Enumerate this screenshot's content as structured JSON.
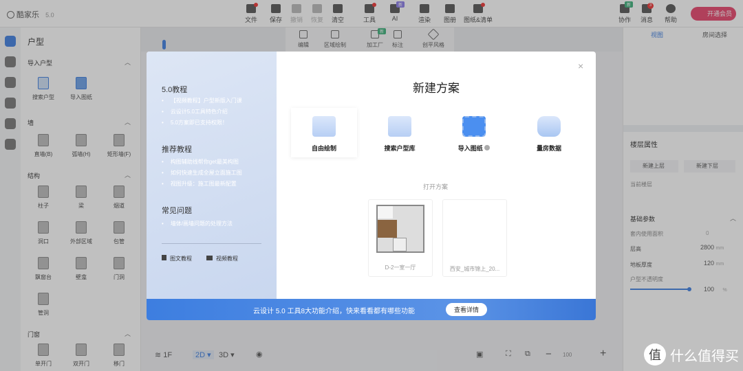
{
  "app": {
    "logo": "酷家乐",
    "version": "5.0"
  },
  "toolbar": [
    {
      "label": "文件",
      "dot": true
    },
    {
      "label": "保存"
    },
    {
      "label": "撤销"
    },
    {
      "label": "恢复"
    },
    {
      "label": "清空"
    },
    {
      "label": "工具",
      "dot": true
    },
    {
      "label": "AI",
      "badge": "新"
    },
    {
      "label": "渲染"
    },
    {
      "label": "图册"
    },
    {
      "label": "图纸&清单",
      "dot": true
    }
  ],
  "toolbar_right": {
    "collab": "协作",
    "collab_badge": "新",
    "messages": "消息",
    "message_count": "3",
    "help": "帮助",
    "vip": "开通会员"
  },
  "subtoolbar": [
    {
      "label": "编辑"
    },
    {
      "label": "区域绘制"
    },
    {
      "label": "加工厂",
      "badge": "新"
    },
    {
      "label": "标注"
    },
    {
      "label": "创平风格"
    }
  ],
  "sidebar": {
    "title": "户型",
    "sections": [
      {
        "title": "导入户型",
        "items": [
          "搜索户型",
          "导入图纸"
        ]
      },
      {
        "title": "墙",
        "items": [
          "直墙(B)",
          "弧墙(H)",
          "矩形墙(F)"
        ]
      },
      {
        "title": "结构",
        "items": [
          "柱子",
          "梁",
          "烟道",
          "洞口",
          "外部区域",
          "包管",
          "飘窗台",
          "壁龛",
          "门洞",
          "管洞"
        ]
      },
      {
        "title": "门窗",
        "items": [
          "单开门",
          "双开门",
          "移门"
        ]
      }
    ]
  },
  "right_panel": {
    "tabs": [
      "视图",
      "房间选择"
    ],
    "floor_title": "楼层属性",
    "new_upper": "新建上层",
    "new_lower": "新建下层",
    "current_floor": "当前楼层",
    "params_title": "基础参数",
    "inner_area": "套内使用面积",
    "inner_area_value": "0",
    "height_label": "层高",
    "height_value": "2800",
    "height_unit": "mm",
    "floor_thick_label": "地板厚度",
    "floor_thick_value": "120",
    "floor_thick_unit": "mm",
    "opacity_label": "户型不透明度",
    "opacity_value": "100",
    "opacity_unit": "%"
  },
  "bottom": {
    "floor": "1F",
    "mode2d": "2D",
    "mode3d": "3D",
    "zoom": "100"
  },
  "modal": {
    "title": "新建方案",
    "left": {
      "sec1": "5.0教程",
      "sec1_items": [
        "【视频教程】户型新版入门课",
        "云设计5.0工具特色介绍",
        "5.0方案即已支持权限！"
      ],
      "sec2": "推荐教程",
      "sec2_items": [
        "构图辅助线帮你get最美构图",
        "如何快速生成全屋立面施工图",
        "视图升级：施工图最新配置"
      ],
      "sec3": "常见问题",
      "sec3_items": [
        "墙体/画墙问题的处理方法"
      ],
      "link_doc": "图文教程",
      "link_video": "视频教程"
    },
    "options": [
      {
        "label": "自由绘制"
      },
      {
        "label": "搜索户型库"
      },
      {
        "label": "导入图纸"
      },
      {
        "label": "量房数据"
      }
    ],
    "open_title": "打开方案",
    "plans": [
      {
        "name": "D-2一室一厅"
      },
      {
        "name": "西安_城市锦上_20..."
      }
    ],
    "banner_text": "云设计 5.0 工具8大功能介绍，快来看看都有哪些功能",
    "banner_button": "查看详情"
  },
  "watermark": {
    "icon": "值",
    "text": "什么值得买"
  },
  "colors": {
    "accent": "#3d7ee0",
    "vip": "#e8436b"
  }
}
